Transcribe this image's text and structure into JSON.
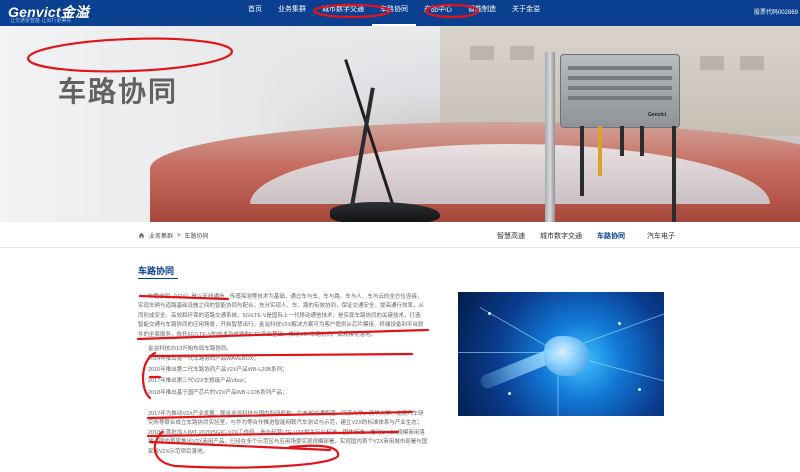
{
  "brand": {
    "logo_text": "Genvict金溢",
    "tagline": "让交通更智能 让出行更美好"
  },
  "nav": {
    "items": [
      "首页",
      "业务集群",
      "城市数字交通",
      "车路协同",
      "产品中心",
      "智能制造",
      "关于金溢"
    ],
    "active_index": 3,
    "stock": "股票代码002869"
  },
  "hero": {
    "title": "车路协同",
    "device_label": "Genvict"
  },
  "breadcrumb": {
    "items": [
      "业务集群",
      "车路协同"
    ],
    "separator": ">"
  },
  "subnav": {
    "items": [
      "智慧高速",
      "城市数字交通",
      "车路协同",
      "汽车电子"
    ],
    "active_index": 2
  },
  "content": {
    "section_title": "车路协同",
    "intro": "车路协同（V2X）是以无线通信、传感探测等技术为基础，通过车与车、车与路、车与人、车与云的全方位连接，实现车辆与道路基础设施之间的智能协同与配合，充分实现人、车、路的有效协同，保证交通安全、提高通行效率，从而形成安全、高效和环保的道路交通系统。5G/LTE-V是国际上一代移动通信技术，是实现车路协同的关键技术，打造智能交通与车路协同的应用场景，开启智慧出行。金溢科技V2X解决方案可为客户提供从芯片模组、终端设备到平台软件的全套服务，依托5G/LTE-V的技术及成熟的ETC产业基础，推动V2X车路协同产品规模化落地。",
    "history_head": "金溢科技2013开始布局车路协同。",
    "history": [
      "2014年推出第一代车路协同产品WAVEBOX；",
      "2016年推出第二代车路协同产品V2X产品WB-L20B系列；",
      "2017年推出第三代V2X车规级产品Vbox；",
      "2018年推出基于国产芯片的V2X产品WB-L10B系列产品；"
    ],
    "para2": "2017年为推动V2X产业发展，联合金溢科技与国内科研机构、广东省交通集团、同济大学、清华大学、北京汽车研究所等联合成立车路协同实验室，与华为等合作推进智能网联汽车测试与示范，建立V2X的标准体系与产业生态；2018年首批加入IMT-2020(5G)C-V2X工作组，参与起草LTE-V2X相关行业标准、团体标准，推动C-V2X规模商用落地，国内首家推出V2X商用产品，已经在多个示范区与应用场景实现规模部署，实现国内首个V2X商用城市部署与国家级V2X示范项目落地。"
  },
  "colors": {
    "nav_bg": "#0b3f8f",
    "accent": "#0b3f8f",
    "annotation": "#e0151b"
  }
}
